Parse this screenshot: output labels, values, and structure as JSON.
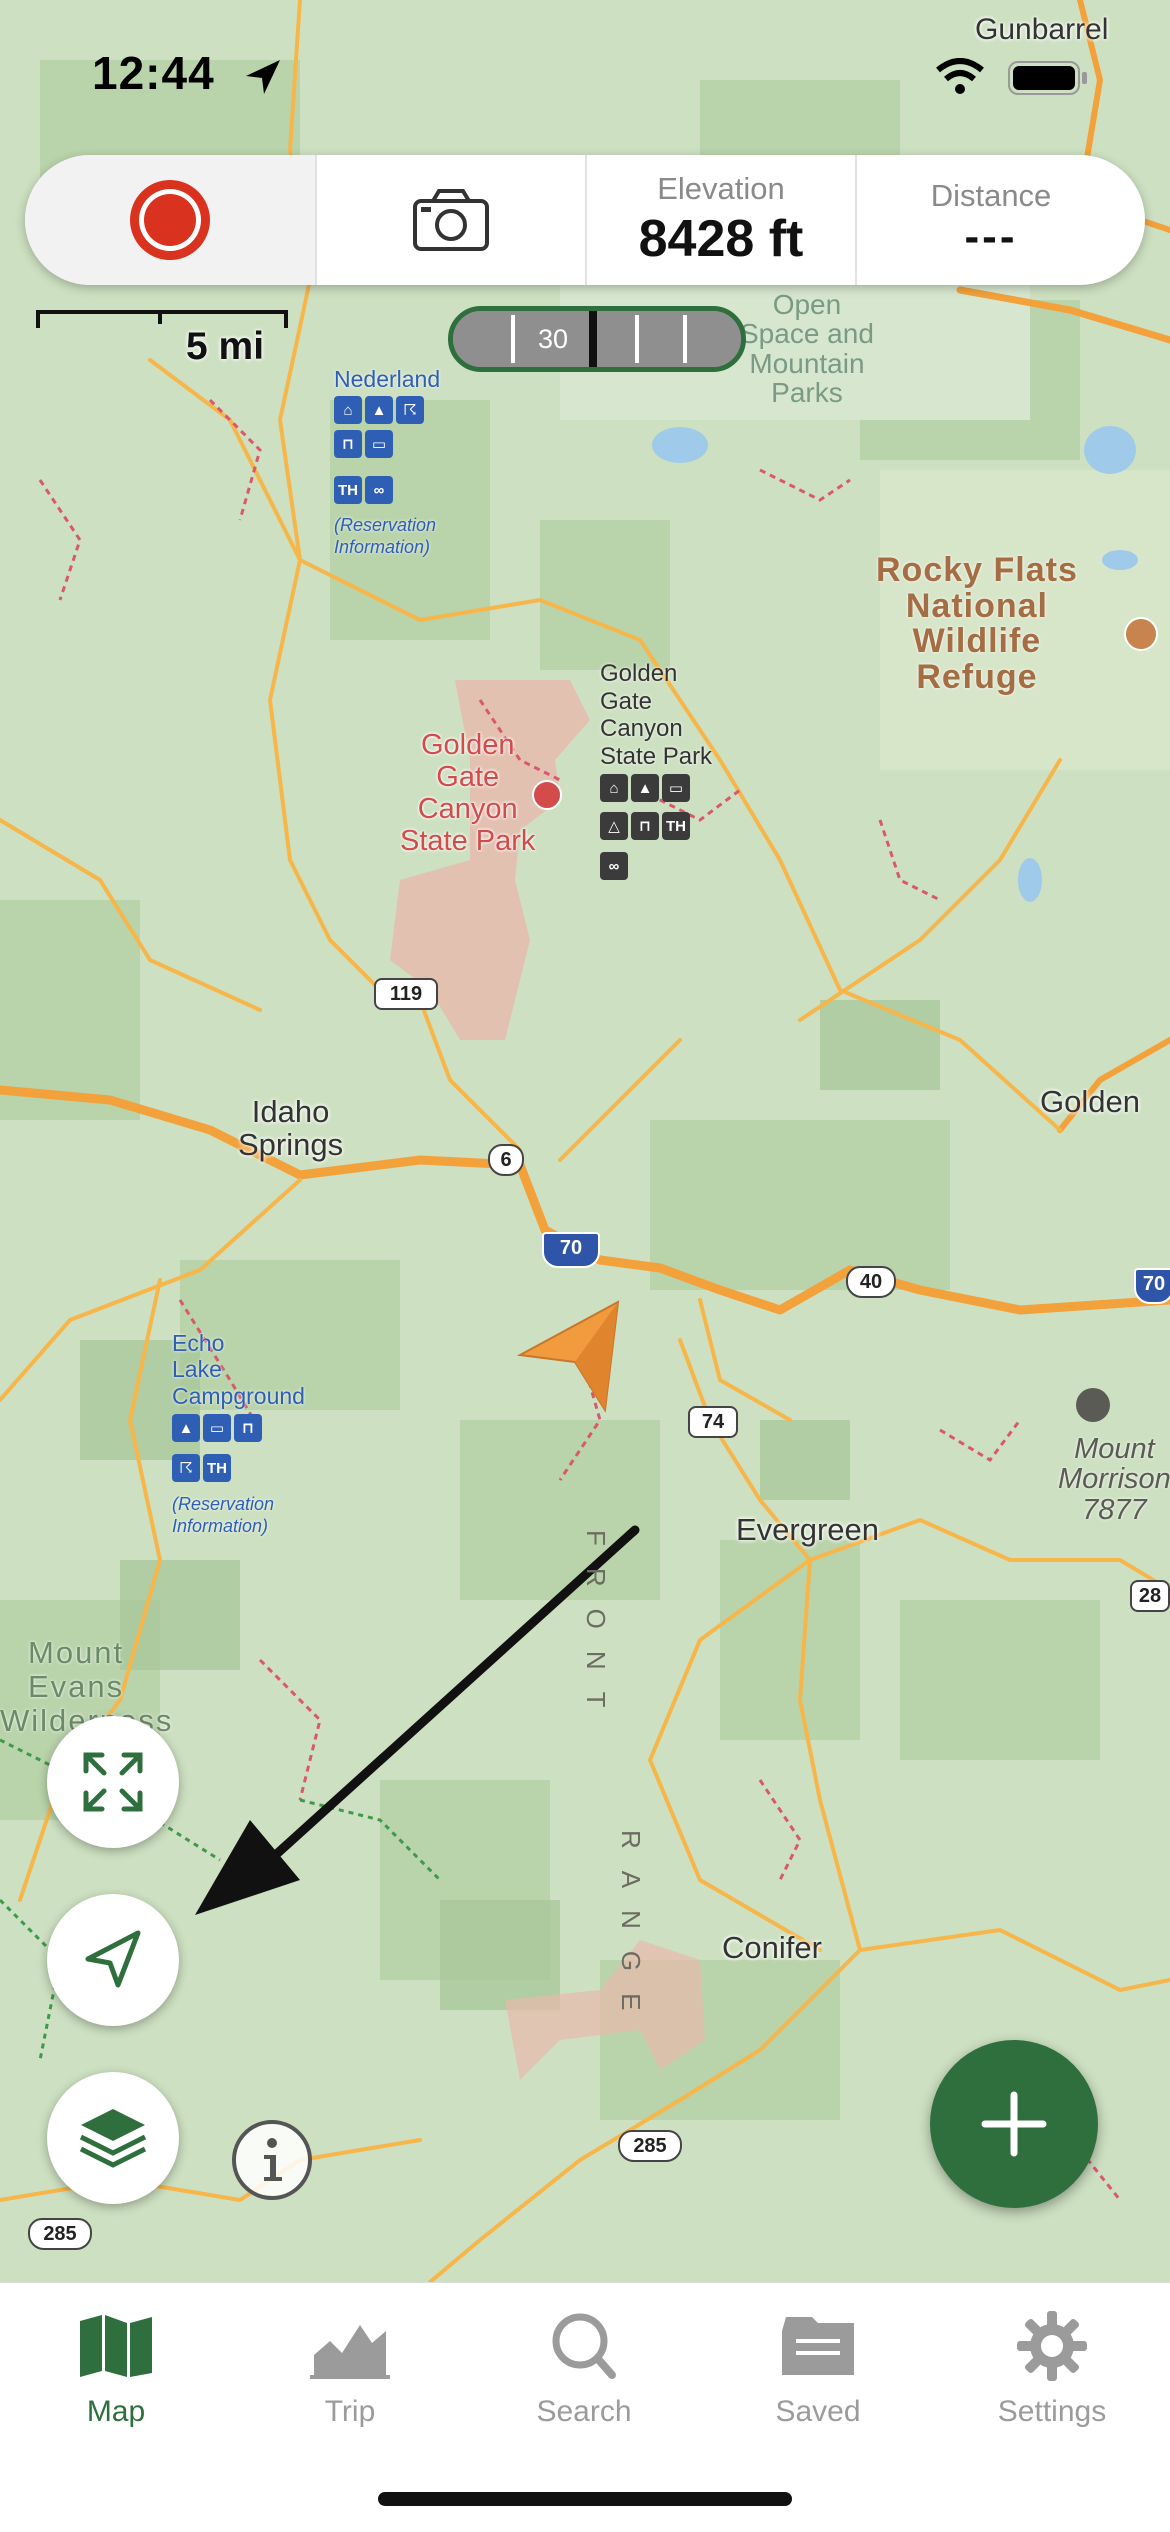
{
  "status_bar": {
    "time": "12:44"
  },
  "stats": {
    "elevation_label": "Elevation",
    "elevation_value": "8428 ft",
    "distance_label": "Distance",
    "distance_value": "---"
  },
  "scale": {
    "label": "5 mi"
  },
  "compass": {
    "heading": "30"
  },
  "map_labels": {
    "gunbarrel": "Gunbarrel",
    "open_space_1": "Open",
    "open_space_2": "Space and",
    "open_space_3": "Mountain",
    "open_space_4": "Parks",
    "nederland": "Nederland",
    "nederland_res_1": "(Reservation",
    "nederland_res_2": "Information)",
    "rocky_1": "Rocky Flats",
    "rocky_2": "National",
    "rocky_3": "Wildlife",
    "rocky_4": "Refuge",
    "ggc_green_1": "Golden",
    "ggc_green_2": "Gate",
    "ggc_green_3": "Canyon",
    "ggc_green_4": "State Park",
    "ggc_red_1": "Golden",
    "ggc_red_2": "Gate",
    "ggc_red_3": "Canyon",
    "ggc_red_4": "State Park",
    "idaho_1": "Idaho",
    "idaho_2": "Springs",
    "golden": "Golden",
    "echo_1": "Echo",
    "echo_2": "Lake",
    "echo_3": "Campground",
    "echo_res_1": "(Reservation",
    "echo_res_2": "Information)",
    "evergreen": "Evergreen",
    "morrison_1": "Mount",
    "morrison_2": "Morrison",
    "morrison_3": "7877",
    "evans_1": "Mount",
    "evans_2": "Evans",
    "evans_3": "Wilderness",
    "conifer": "Conifer",
    "front": "FRONT",
    "range": "RANGE"
  },
  "shields": {
    "hwy119": "119",
    "us6": "6",
    "i70": "70",
    "us40": "40",
    "hwy74": "74",
    "us285_a": "285",
    "us285_b": "285",
    "i70_edge": "70",
    "hwy28": "28"
  },
  "tabs": [
    {
      "label": "Map",
      "icon": "map-icon"
    },
    {
      "label": "Trip",
      "icon": "chart-icon"
    },
    {
      "label": "Search",
      "icon": "search-icon"
    },
    {
      "label": "Saved",
      "icon": "folder-icon"
    },
    {
      "label": "Settings",
      "icon": "gear-icon"
    }
  ],
  "colors": {
    "brand_green": "#2f6f3e",
    "record_red": "#d9321f",
    "location_orange": "#f19a3e",
    "road_orange": "#f2a13b"
  }
}
